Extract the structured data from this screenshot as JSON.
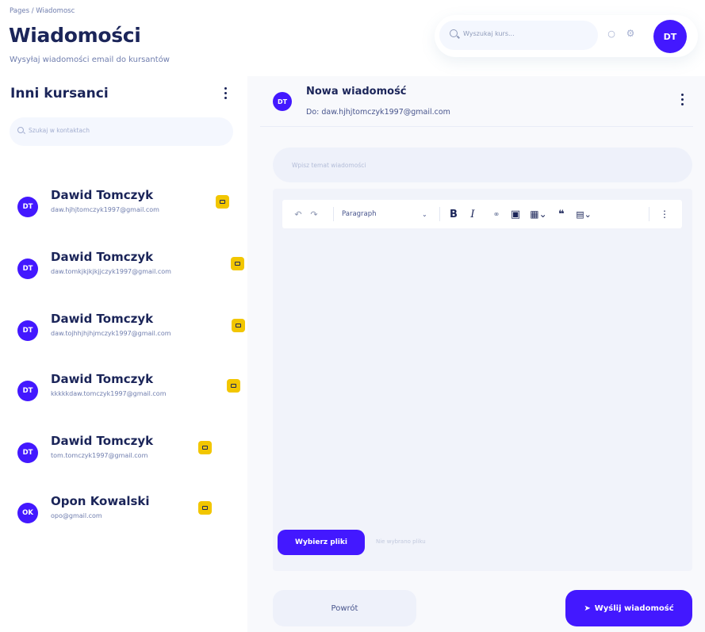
{
  "header": {
    "breadcrumb": "Pages / Wiadomosc",
    "title": "Wiadomości",
    "subtitle": "Wysyłaj wiadomości email do kursantów"
  },
  "topbar": {
    "search_placeholder": "Wyszukaj kurs...",
    "avatar_initials": "DT",
    "icons": [
      "search-icon",
      "bell-icon",
      "gear-icon"
    ]
  },
  "contacts_panel": {
    "title": "Inni kursanci",
    "search_placeholder": "Szukaj w kontaktach",
    "contacts": [
      {
        "initials": "DT",
        "name": "Dawid Tomczyk",
        "email": "daw.hjhjtomczyk1997@gmail.com"
      },
      {
        "initials": "DT",
        "name": "Dawid Tomczyk",
        "email": "daw.tomkjkjkjkjjczyk1997@gmail.com"
      },
      {
        "initials": "DT",
        "name": "Dawid Tomczyk",
        "email": "daw.tojhhjhjhjmczyk1997@gmail.com"
      },
      {
        "initials": "DT",
        "name": "Dawid Tomczyk",
        "email": "kkkkkdaw.tomczyk1997@gmail.com"
      },
      {
        "initials": "DT",
        "name": "Dawid Tomczyk",
        "email": "tom.tomczyk1997@gmail.com"
      },
      {
        "initials": "OK",
        "name": "Opon Kowalski",
        "email": "opo@gmail.com"
      }
    ]
  },
  "compose": {
    "avatar_initials": "DT",
    "title": "Nowa wiadomość",
    "to": "Do: daw.hjhjtomczyk1997@gmail.com",
    "subject_placeholder": "Wpisz temat wiadomości",
    "editor": {
      "paragraph_style": "Paragraph",
      "toolbar_icons": [
        "undo-icon",
        "redo-icon",
        "bold-icon",
        "italic-icon",
        "link-icon",
        "image-icon",
        "table-icon",
        "quote-icon",
        "media-icon",
        "more-icon"
      ]
    },
    "file_button": "Wybierz pliki",
    "file_status": "Nie wybrano pliku",
    "back_button": "Powrót",
    "send_button": "Wyślij wiadomość"
  },
  "colors": {
    "primary": "#4318ff",
    "title": "#1b2559",
    "muted": "#707eae",
    "mail_badge": "#f2c600",
    "panel_bg": "#f8f9fc"
  }
}
